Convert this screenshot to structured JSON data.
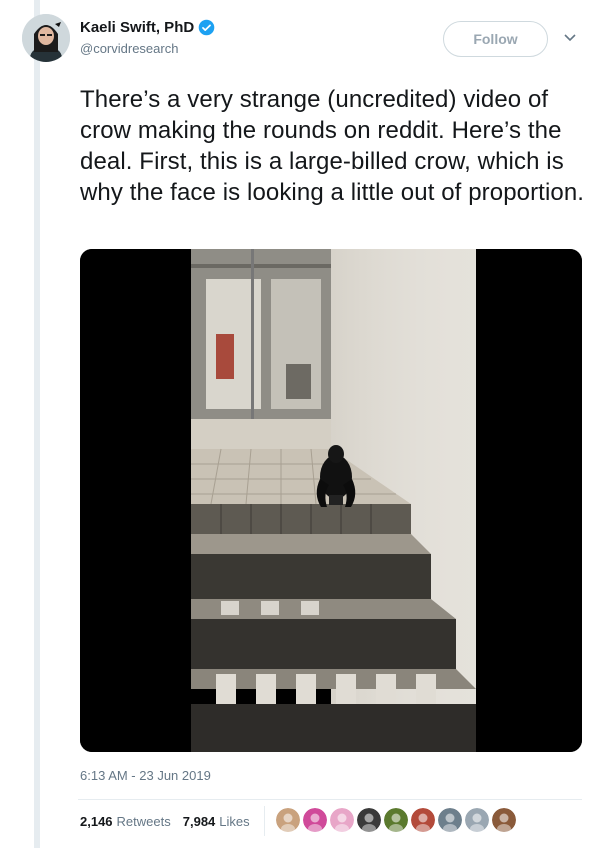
{
  "author": {
    "display_name": "Kaeli Swift, PhD",
    "handle": "@corvidresearch",
    "verified": true
  },
  "follow_label": "Follow",
  "tweet_text": "There’s a very strange (uncredited) video of crow making the rounds on reddit. Here’s the deal. First, this is a large-billed crow, which is why the face is looking a little out of proportion.",
  "timestamp": "6:13 AM - 23 Jun 2019",
  "stats": {
    "retweets_count": "2,146",
    "retweets_label": "Retweets",
    "likes_count": "7,984",
    "likes_label": "Likes"
  },
  "liker_avatars": [
    {
      "color": "#c9a27e",
      "icon": "person-avatar"
    },
    {
      "color": "#d04a9a",
      "icon": "person-avatar"
    },
    {
      "color": "#e8a6c8",
      "icon": "person-avatar"
    },
    {
      "color": "#3a3a3a",
      "icon": "nun-avatar"
    },
    {
      "color": "#5b7a2e",
      "icon": "person-avatar"
    },
    {
      "color": "#b34a3a",
      "icon": "person-avatar"
    },
    {
      "color": "#6d7f8c",
      "icon": "person-avatar"
    },
    {
      "color": "#9aa7b2",
      "icon": "default-egg-avatar"
    },
    {
      "color": "#8a5a3a",
      "icon": "person-avatar"
    }
  ],
  "colors": {
    "verified_blue": "#1da1f2",
    "secondary_text": "#657786",
    "primary_text": "#14171a"
  }
}
